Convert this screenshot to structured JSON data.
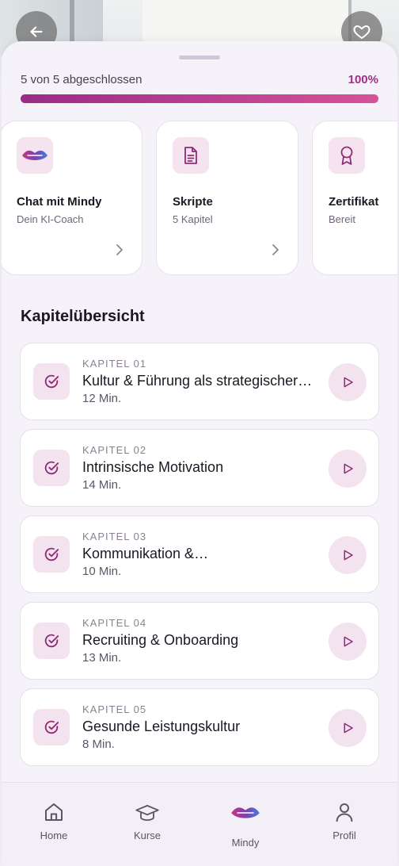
{
  "progress": {
    "label": "5 von 5 abgeschlossen",
    "percent_label": "100%",
    "value": 1.0
  },
  "quick_cards": [
    {
      "title": "Chat mit Mindy",
      "subtitle": "Dein KI-Coach",
      "icon": "mindy-lips-icon"
    },
    {
      "title": "Skripte",
      "subtitle": "5 Kapitel",
      "icon": "document-icon"
    },
    {
      "title": "Zertifikat",
      "subtitle": "Bereit",
      "icon": "award-icon"
    }
  ],
  "section_title": "Kapitelübersicht",
  "chapters": [
    {
      "number": "KAPITEL 01",
      "title": "Kultur & Führung als strategischer Erfolgsfaktor",
      "duration": "12 Min."
    },
    {
      "number": "KAPITEL 02",
      "title": "Intrinsische Motivation",
      "duration": "14 Min."
    },
    {
      "number": "KAPITEL 03",
      "title": "Kommunikation &…",
      "duration": "10 Min."
    },
    {
      "number": "KAPITEL 04",
      "title": "Recruiting & Onboarding",
      "duration": "13 Min."
    },
    {
      "number": "KAPITEL 05",
      "title": "Gesunde Leistungskultur",
      "duration": "8 Min."
    }
  ],
  "tabs": [
    {
      "label": "Home",
      "icon": "home-icon"
    },
    {
      "label": "Kurse",
      "icon": "graduation-cap-icon"
    },
    {
      "label": "Mindy",
      "icon": "mindy-lips-icon"
    },
    {
      "label": "Profil",
      "icon": "user-icon"
    }
  ],
  "colors": {
    "accent": "#a32f86",
    "accent_light": "#f3e3ef",
    "progress_end": "#d5539a"
  }
}
